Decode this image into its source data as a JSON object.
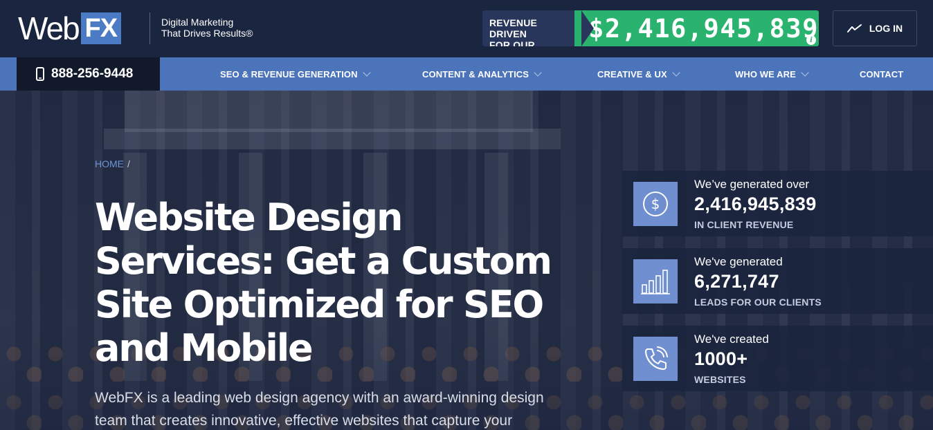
{
  "header": {
    "logo_web": "Web",
    "logo_fx": "FX",
    "tagline_line1": "Digital Marketing",
    "tagline_line2": "That Drives Results®",
    "revenue_label_line1": "REVENUE DRIVEN",
    "revenue_label_line2": "FOR OUR CLIENTS",
    "revenue_amount": "$2,416,945,839",
    "info_glyph": "i",
    "login_label": "LOG IN"
  },
  "nav": {
    "phone": "888-256-9448",
    "items": [
      {
        "label": "SEO & REVENUE GENERATION",
        "has_dropdown": true
      },
      {
        "label": "CONTENT & ANALYTICS",
        "has_dropdown": true
      },
      {
        "label": "CREATIVE & UX",
        "has_dropdown": true
      },
      {
        "label": "WHO WE ARE",
        "has_dropdown": true
      },
      {
        "label": "CONTACT",
        "has_dropdown": false
      }
    ]
  },
  "hero": {
    "breadcrumb_home": "HOME",
    "breadcrumb_sep": "/",
    "title": "Website Design Services: Get a Custom Site Optimized for SEO and Mobile",
    "description": "WebFX is a leading web design agency with an award-winning design team that creates innovative, effective websites that capture your"
  },
  "stats": [
    {
      "icon": "dollar-circle-icon",
      "pre": "We’ve generated over",
      "number": "2,416,945,839",
      "post": "IN CLIENT REVENUE"
    },
    {
      "icon": "bar-chart-icon",
      "pre": "We've generated",
      "number": "6,271,747",
      "post": "LEADS FOR OUR CLIENTS"
    },
    {
      "icon": "phone-call-icon",
      "pre": "We've created",
      "number": "1000+",
      "post": "WEBSITES"
    }
  ],
  "colors": {
    "topbar_bg": "#1a2540",
    "nav_bg": "#4b74ba",
    "revenue_green": "#2ab36e",
    "logo_fx_blue": "#4c7bc5",
    "stat_icon_bg": "#6f8fd0"
  }
}
